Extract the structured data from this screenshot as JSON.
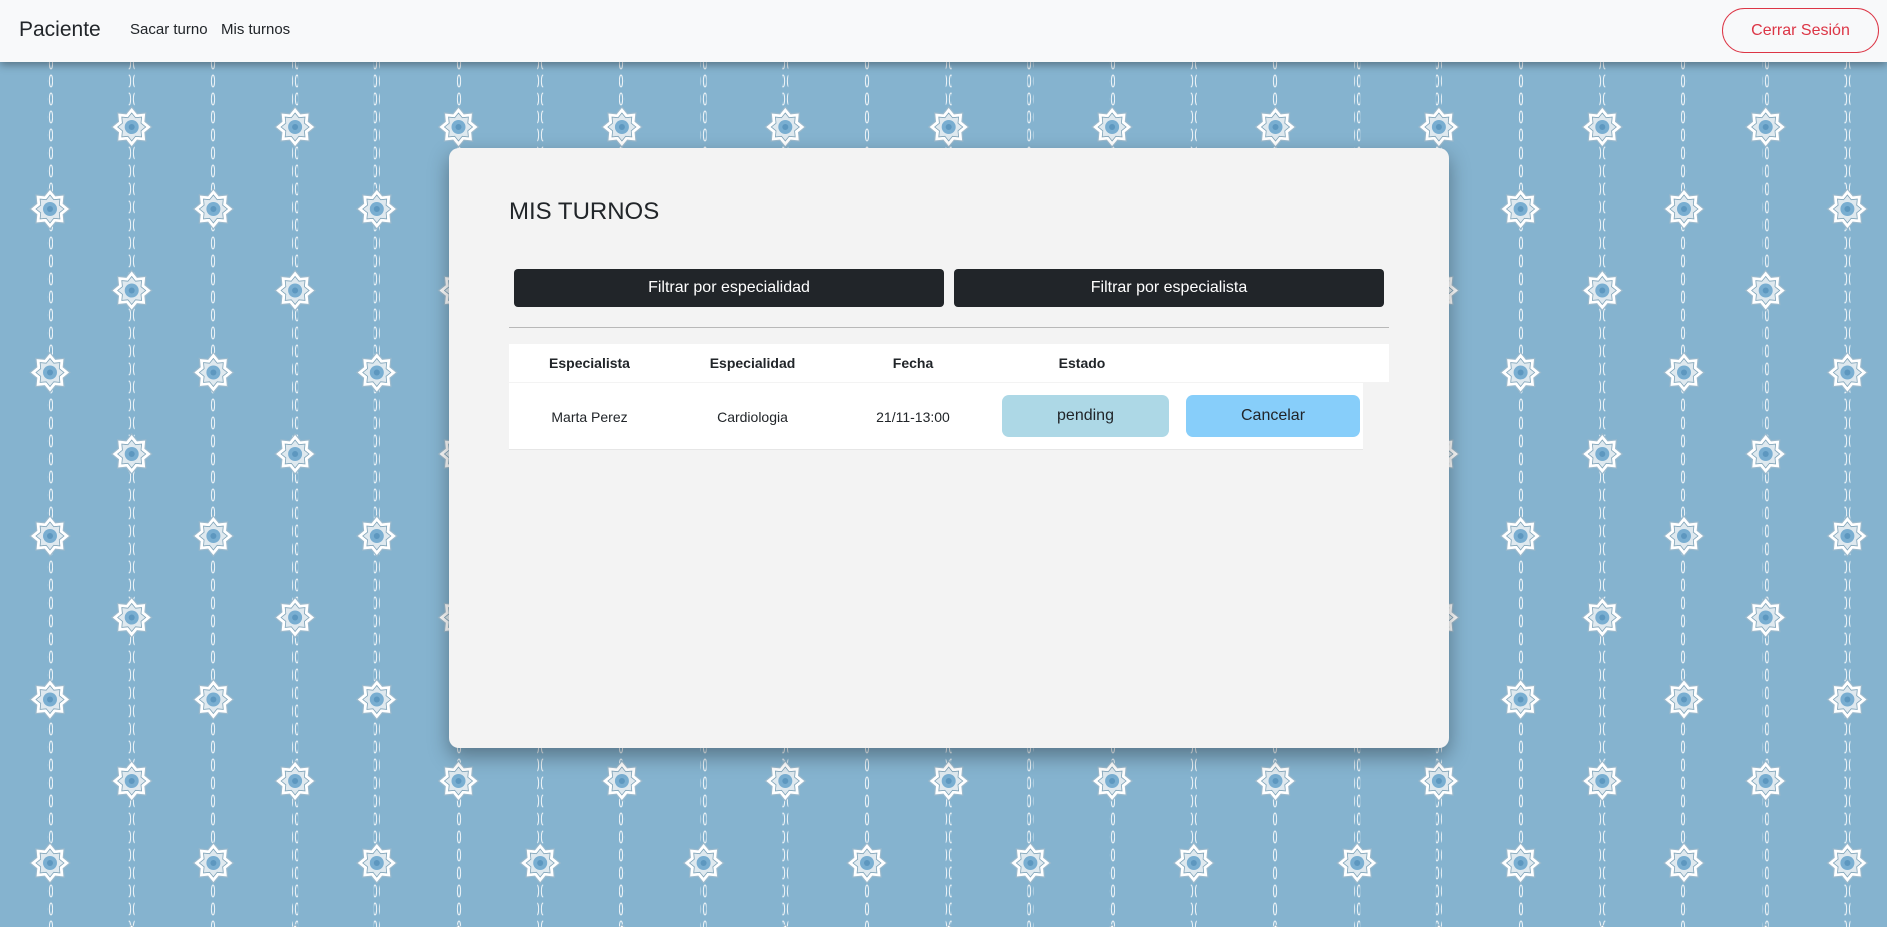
{
  "theme": {
    "background": "#85b3cf",
    "navbar_bg": "#f8f9fa",
    "logout_color": "#dc3545",
    "filter_button_bg": "#212529",
    "status_button_bg": "#add8e6",
    "cancel_button_bg": "#87cefa",
    "card_bg": "#f3f3f3"
  },
  "navbar": {
    "brand": "Paciente",
    "links": [
      {
        "label": "Sacar turno"
      },
      {
        "label": "Mis turnos"
      }
    ],
    "logout_label": "Cerrar Sesión"
  },
  "main": {
    "title": "MIS TURNOS",
    "filters": {
      "by_specialty": "Filtrar por especialidad",
      "by_specialist": "Filtrar por especialista"
    },
    "table": {
      "headers": [
        "Especialista",
        "Especialidad",
        "Fecha",
        "Estado"
      ],
      "rows": [
        {
          "especialista": "Marta Perez",
          "especialidad": "Cardiologia",
          "fecha": "21/11-13:00",
          "estado": "pending",
          "action_label": "Cancelar"
        }
      ]
    }
  },
  "background_pattern": {
    "icon": "star-ornament-icon",
    "description_colors": {
      "chain": "#e9f1f6",
      "star_outer": "#ffffff",
      "star_inner": "#7aaed0"
    }
  }
}
